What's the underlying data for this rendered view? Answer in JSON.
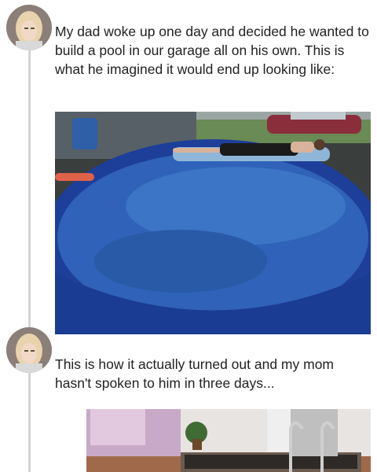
{
  "posts": [
    {
      "avatar_icon": "user-avatar-icon",
      "text": "My dad woke up one day and decided he wanted to build a pool in our garage all on his own. This is what he imagined it would end up looking like:",
      "image_alt": "pool-photo"
    },
    {
      "avatar_icon": "user-avatar-icon",
      "text": "This is how it actually turned out and my mom hasn't spoken to him in three days...",
      "image_alt": "garage-photo"
    }
  ],
  "colors": {
    "thread_line": "#d4d4d4",
    "pool_water": "#2f62b8",
    "pool_rim": "#1d3f9a"
  }
}
